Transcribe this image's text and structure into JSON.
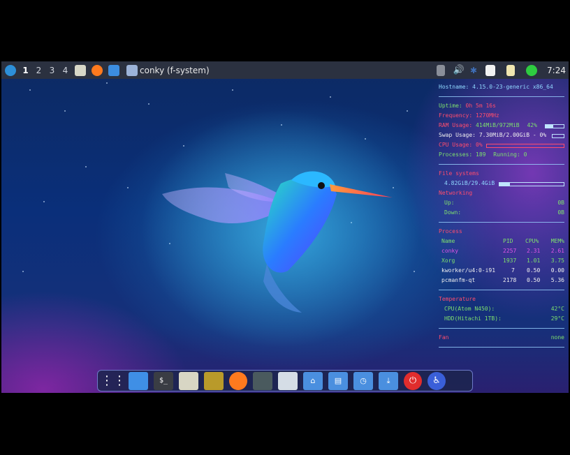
{
  "panel": {
    "workspaces": [
      "1",
      "2",
      "3",
      "4"
    ],
    "active_task": "conky (f-system)",
    "clock": "7:24"
  },
  "conky": {
    "header": "Hostname: 4.15.0-23-generic x86_64",
    "uptime_label": "Uptime:",
    "uptime_value": "0h 5m 16s",
    "frequency_label": "Frequency:",
    "frequency_value": "1270MHz",
    "ram_label": "RAM Usage:",
    "ram_value": "414MiB/972MiB",
    "ram_pct": "42%",
    "ram_fraction": 0.42,
    "swap_label": "Swap Usage:",
    "swap_value": "7.30MiB/2.00GiB - 0%",
    "swap_fraction": 0.0,
    "cpu_label": "CPU Usage:",
    "cpu_value": "0%",
    "cpu_fraction": 0.0,
    "processes_label": "Processes:",
    "processes_value": "189",
    "running_label": "Running:",
    "running_value": "0",
    "fs_label": "File systems",
    "fs_value": "4.82GiB/29.4GiB",
    "fs_fraction": 0.16,
    "net_label": "Networking",
    "up_label": "Up:",
    "up_value": "0B",
    "down_label": "Down:",
    "down_value": "0B",
    "proc_title": "Process",
    "proc_headers": [
      "Name",
      "PID",
      "CPU%",
      "MEM%"
    ],
    "proc_rows": [
      [
        "conky",
        "2257",
        "2.31",
        "2.61"
      ],
      [
        "Xorg",
        "1937",
        "1.01",
        "3.75"
      ],
      [
        "kworker/u4:0-i91",
        "7",
        "0.50",
        "0.00"
      ],
      [
        "pcmanfm-qt",
        "2178",
        "0.50",
        "5.36"
      ]
    ],
    "temp_title": "Temperature",
    "cpu_temp_label": "CPU(Atom N450):",
    "cpu_temp_value": "42°C",
    "hdd_temp_label": "HDD(Hitachi 1TB):",
    "hdd_temp_value": "29°C",
    "fan_label": "Fan",
    "fan_value": "none"
  },
  "colors": {
    "panel_bg": "#2b3140",
    "conky_green": "#7ee06e",
    "conky_red": "#ff4d6d",
    "conky_magenta": "#e055e6"
  },
  "dock_icons": [
    "app-grid-icon",
    "file-manager-icon",
    "terminal-icon",
    "archive-icon",
    "image-viewer-icon",
    "firefox-icon",
    "screenshot-icon",
    "display-icon",
    "home-folder-icon",
    "documents-folder-icon",
    "recent-folder-icon",
    "downloads-folder-icon",
    "power-icon",
    "accessibility-icon"
  ]
}
